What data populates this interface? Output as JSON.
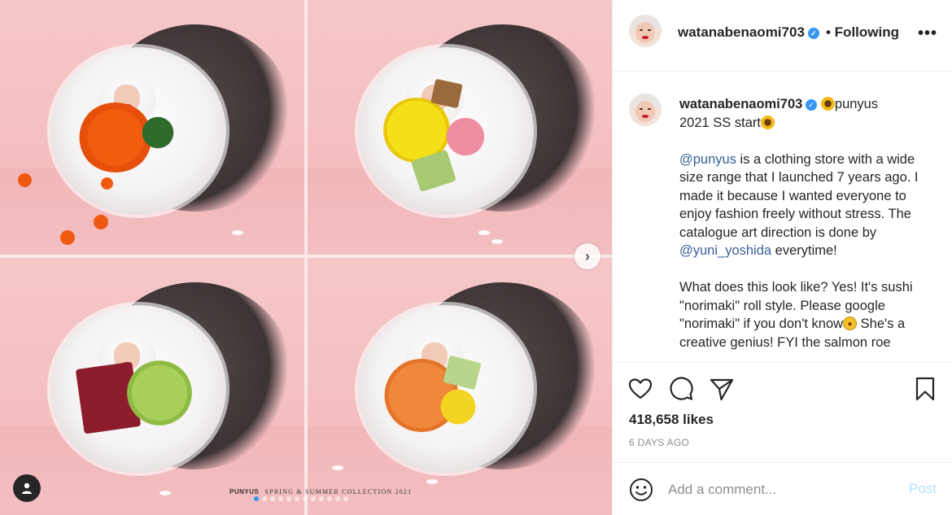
{
  "post": {
    "username": "watanabenaomi703",
    "follow_state": "• Following",
    "more": "•••",
    "verified_mark": "✓"
  },
  "media": {
    "brand": "PUNYUS",
    "brand_caption": "SPRING & SUMMER COLLECTION 2021",
    "carousel_count": 12,
    "carousel_active_index": 0,
    "next_arrow": "›"
  },
  "caption": {
    "username": "watanabenaomi703",
    "line1_text": "punyus",
    "line2_text": "2021 SS start",
    "p1_mention": "@punyus",
    "p1_text_a": " is a clothing store with a wide size range that I launched 7 years ago. I made it because I wanted everyone to enjoy fashion freely without stress. The catalogue art direction is done by ",
    "p1_mention2": "@yuni_yoshida",
    "p1_text_b": " everytime!",
    "p2_text_a": "What does this look like? Yes! It's sushi \"norimaki\" roll style. Please google \"norimaki\" if you don't know",
    "p2_text_b": " She's a creative genius! FYI the salmon roe"
  },
  "actions": {
    "likes": "418,658 likes",
    "date": "6 DAYS AGO"
  },
  "comment": {
    "placeholder": "Add a comment...",
    "post_label": "Post"
  },
  "colors": {
    "accent_blue": "#3897f0",
    "post_disabled": "#b2dffc",
    "muted": "#8e8e8e",
    "text": "#262626",
    "background_pink": "#f4c0c3"
  }
}
